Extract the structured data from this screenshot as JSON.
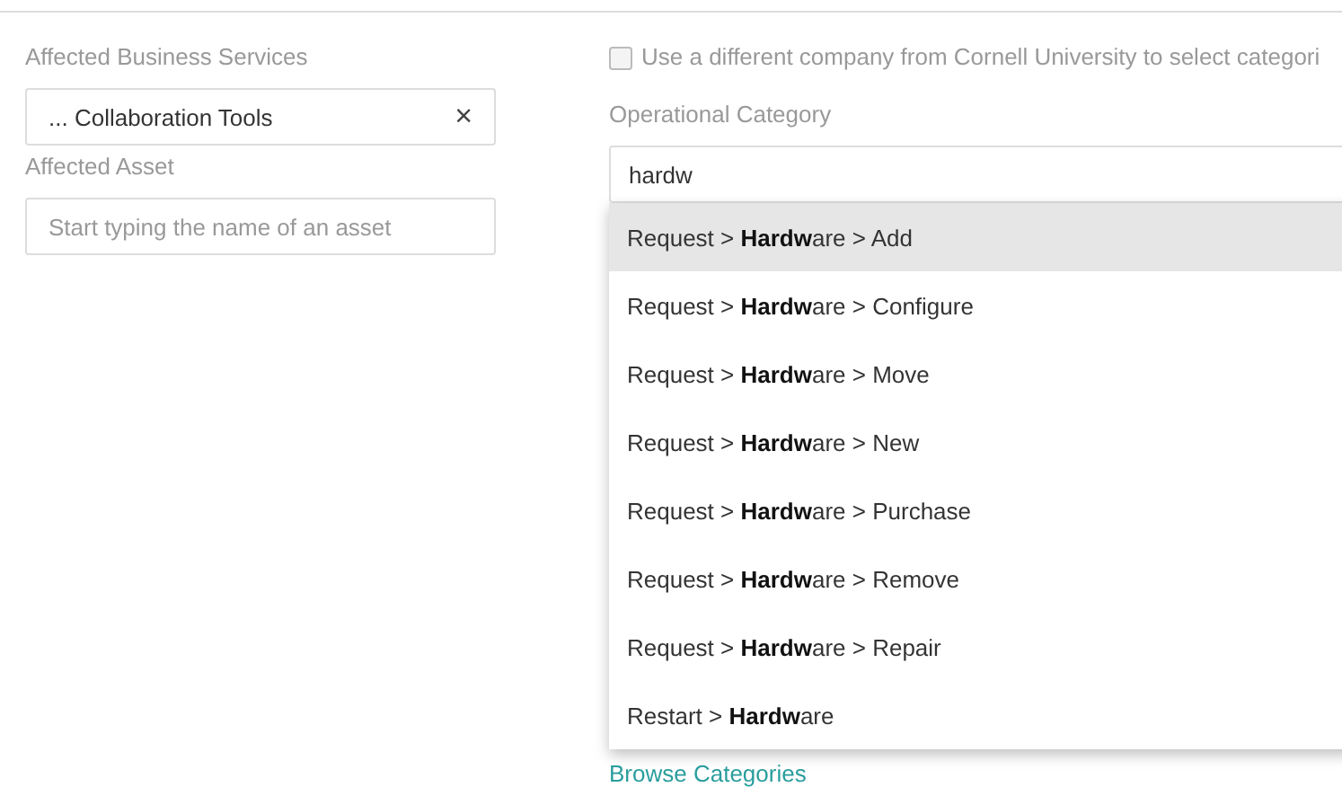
{
  "left": {
    "business_services": {
      "label": "Affected Business Services",
      "value": "... Collaboration Tools",
      "clear": "×"
    },
    "asset": {
      "label": "Affected Asset",
      "placeholder": "Start typing the name of an asset"
    }
  },
  "right": {
    "different_company": {
      "label": "Use a different company from Cornell University to select categori",
      "checked": false
    },
    "category": {
      "label": "Operational Category",
      "value": "hardw",
      "options": [
        {
          "text": "Request > **Hardw**are > Add",
          "selected": true
        },
        {
          "text": "Request > **Hardw**are > Configure",
          "selected": false
        },
        {
          "text": "Request > **Hardw**are > Move",
          "selected": false
        },
        {
          "text": "Request > **Hardw**are > New",
          "selected": false
        },
        {
          "text": "Request > **Hardw**are > Purchase",
          "selected": false
        },
        {
          "text": "Request > **Hardw**are > Remove",
          "selected": false
        },
        {
          "text": "Request > **Hardw**are > Repair",
          "selected": false
        },
        {
          "text": "Restart > **Hardw**are",
          "selected": false
        }
      ],
      "browse_link": "Browse Categories"
    }
  }
}
